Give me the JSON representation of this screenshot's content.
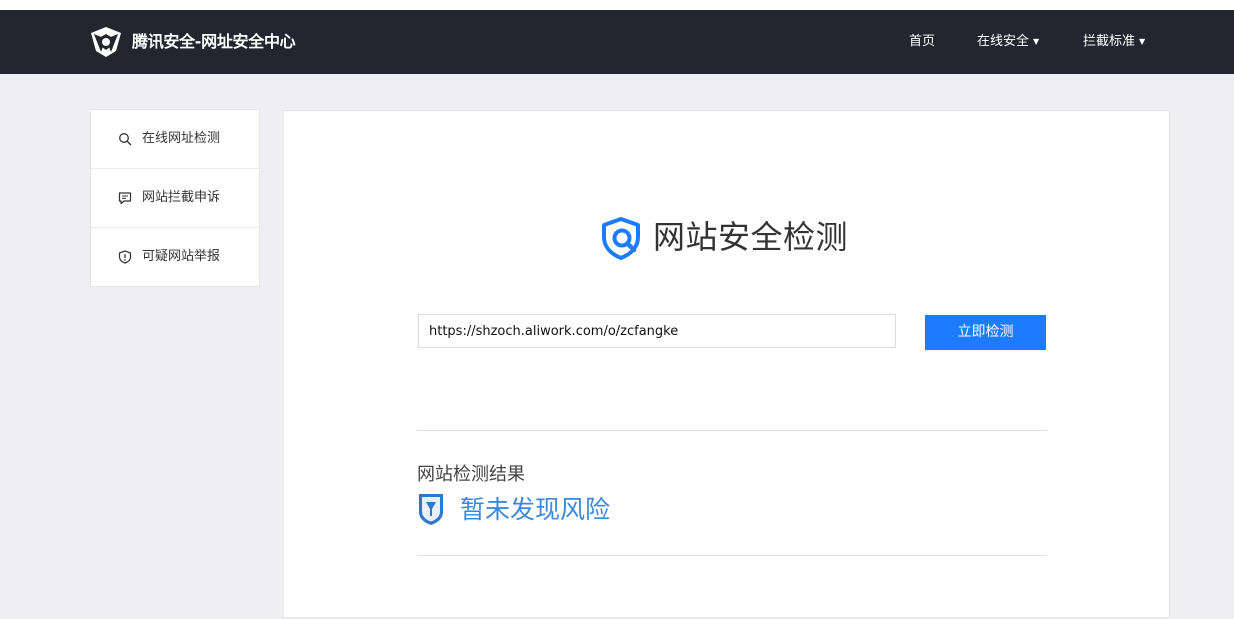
{
  "header": {
    "site_title": "腾讯安全-网址安全中心",
    "nav": [
      {
        "label": "首页",
        "has_dropdown": false
      },
      {
        "label": "在线安全",
        "has_dropdown": true
      },
      {
        "label": "拦截标准",
        "has_dropdown": true
      }
    ],
    "caret": "▼"
  },
  "sidebar": {
    "items": [
      {
        "label": "在线网址检测",
        "icon": "search-icon"
      },
      {
        "label": "网站拦截申诉",
        "icon": "comment-icon"
      },
      {
        "label": "可疑网站举报",
        "icon": "shield-alert-icon"
      }
    ]
  },
  "main": {
    "brand_title": "网站安全检测",
    "url_input": {
      "value": "https://shzoch.aliwork.com/o/zcfangke",
      "placeholder": ""
    },
    "check_button": "立即检测",
    "result_label": "网站检测结果",
    "result_value": "暂未发现风险"
  },
  "colors": {
    "header_bg": "#23252f",
    "accent": "#1d7bff",
    "result_text": "#3b8ad9",
    "page_bg": "#efeff3"
  }
}
